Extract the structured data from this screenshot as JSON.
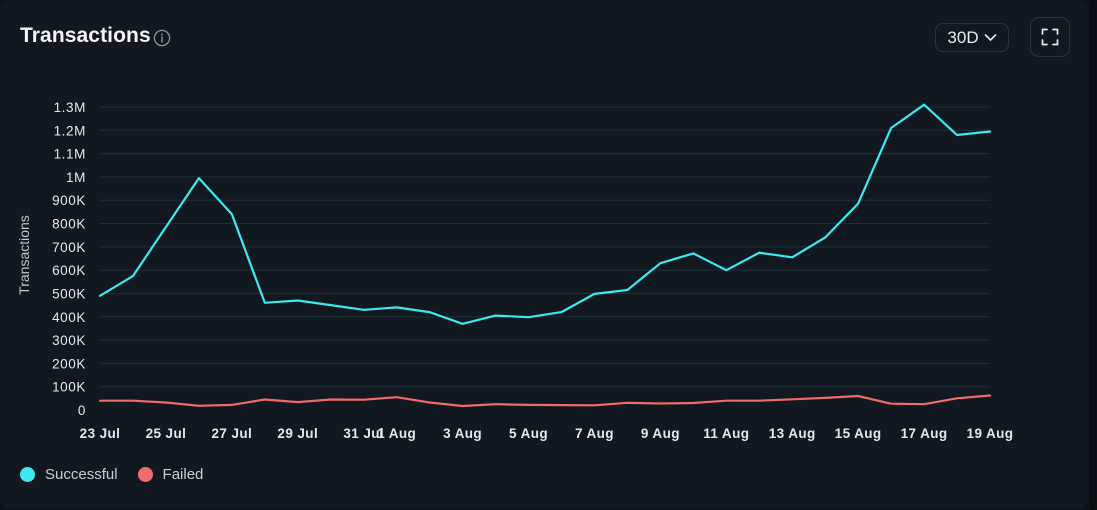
{
  "header": {
    "title": "Transactions",
    "range_label": "30D"
  },
  "icons": {
    "info": "info-icon",
    "range_dropdown": "chevron-down-icon",
    "expand": "fullscreen-icon"
  },
  "colors": {
    "successful": "#3ee8f0",
    "failed": "#f06b6b",
    "grid": "#1c2e3c",
    "tick_text": "#e6e9ec",
    "axis_label": "#c2c7cd"
  },
  "legend": {
    "items": [
      {
        "label": "Successful"
      },
      {
        "label": "Failed"
      }
    ]
  },
  "chart_data": {
    "type": "line",
    "title": "Transactions",
    "xlabel": "",
    "ylabel": "Transactions",
    "ylim": [
      0,
      1300000
    ],
    "grid": true,
    "legend_position": "bottom-left",
    "yticks": [
      0,
      100000,
      200000,
      300000,
      400000,
      500000,
      600000,
      700000,
      800000,
      900000,
      1000000,
      1100000,
      1200000,
      1300000
    ],
    "ytick_labels": [
      "0",
      "100K",
      "200K",
      "300K",
      "400K",
      "500K",
      "600K",
      "700K",
      "800K",
      "900K",
      "1M",
      "1.1M",
      "1.2M",
      "1.3M"
    ],
    "x": [
      "23 Jul",
      "24 Jul",
      "25 Jul",
      "26 Jul",
      "27 Jul",
      "28 Jul",
      "29 Jul",
      "30 Jul",
      "31 Jul",
      "1 Aug",
      "2 Aug",
      "3 Aug",
      "4 Aug",
      "5 Aug",
      "6 Aug",
      "7 Aug",
      "8 Aug",
      "9 Aug",
      "10 Aug",
      "11 Aug",
      "12 Aug",
      "13 Aug",
      "14 Aug",
      "15 Aug",
      "16 Aug",
      "17 Aug",
      "18 Aug",
      "19 Aug"
    ],
    "xtick_labels": [
      "23 Jul",
      "25 Jul",
      "27 Jul",
      "29 Jul",
      "31 Jul",
      "1 Aug",
      "3 Aug",
      "5 Aug",
      "7 Aug",
      "9 Aug",
      "11 Aug",
      "13 Aug",
      "15 Aug",
      "17 Aug",
      "19 Aug"
    ],
    "xtick_dates": [
      "23 Jul",
      "25 Jul",
      "27 Jul",
      "29 Jul",
      "31 Jul",
      "1 Aug",
      "3 Aug",
      "5 Aug",
      "7 Aug",
      "9 Aug",
      "11 Aug",
      "13 Aug",
      "15 Aug",
      "17 Aug",
      "19 Aug"
    ],
    "series": [
      {
        "name": "Successful",
        "values": [
          490000,
          575000,
          785000,
          995000,
          840000,
          460000,
          470000,
          450000,
          430000,
          440000,
          420000,
          370000,
          405000,
          398000,
          420000,
          498000,
          515000,
          630000,
          672000,
          600000,
          675000,
          655000,
          740000,
          885000,
          1210000,
          1310000,
          1180000,
          1195000
        ]
      },
      {
        "name": "Failed",
        "values": [
          40000,
          40000,
          32000,
          18000,
          22000,
          45000,
          34000,
          45000,
          44000,
          55000,
          32000,
          17000,
          25000,
          22000,
          21000,
          20000,
          31000,
          28000,
          30000,
          40000,
          40000,
          46000,
          52000,
          60000,
          27000,
          25000,
          50000,
          62000
        ]
      }
    ]
  }
}
